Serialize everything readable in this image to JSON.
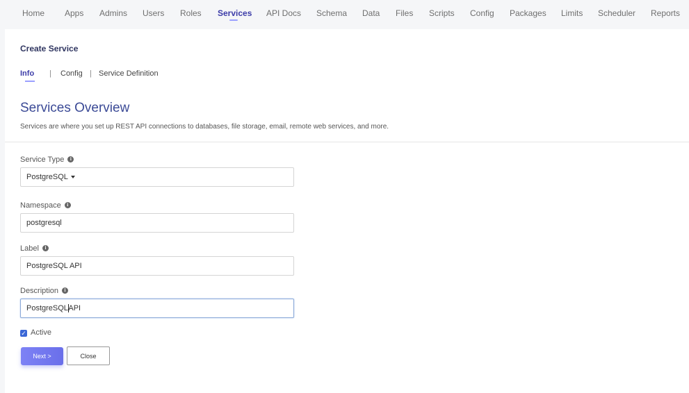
{
  "nav": {
    "items": [
      "Home",
      "Apps",
      "Admins",
      "Users",
      "Roles",
      "Services",
      "API Docs",
      "Schema",
      "Data",
      "Files",
      "Scripts",
      "Config",
      "Packages",
      "Limits",
      "Scheduler",
      "Reports"
    ],
    "active": "Services"
  },
  "panel": {
    "title": "Create Service",
    "subtabs": {
      "info": "Info",
      "config": "Config",
      "service_definition": "Service Definition",
      "separator": "|"
    },
    "overview_heading": "Services Overview",
    "overview_desc": "Services are where you set up REST API connections to databases, file storage, email, remote web services, and more."
  },
  "form": {
    "service_type": {
      "label": "Service Type",
      "value": "PostgreSQL"
    },
    "namespace": {
      "label": "Namespace",
      "value": "postgresql"
    },
    "label_field": {
      "label": "Label",
      "value": "PostgreSQL API"
    },
    "description": {
      "label": "Description",
      "value_before_cursor": "PostgreSQL",
      "value_after_cursor": " API"
    },
    "active": {
      "label": "Active",
      "checked": true
    },
    "info_icon_glyph": "i"
  },
  "buttons": {
    "next": "Next >",
    "close": "Close"
  },
  "colors": {
    "accent": "#3c3ca8",
    "heading": "#3b4a96",
    "checkbox": "#3b67d6",
    "next_button": "#7579f0"
  }
}
